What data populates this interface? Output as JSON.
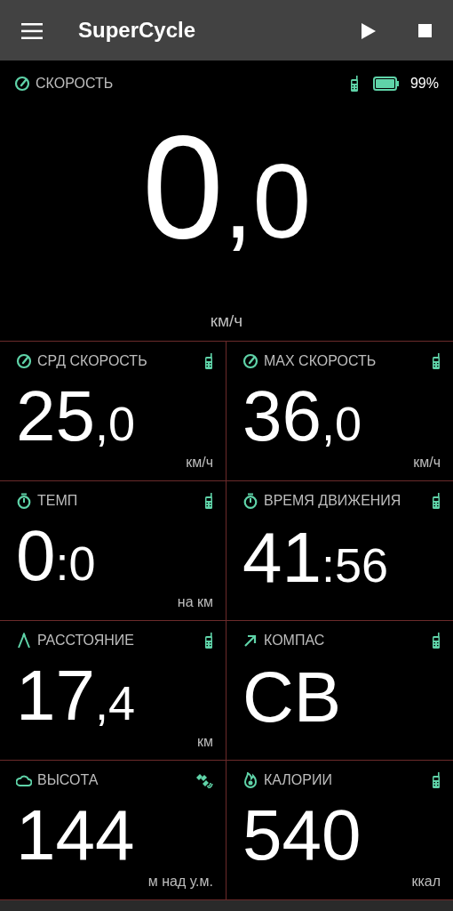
{
  "app_bar": {
    "title": "SuperCycle"
  },
  "speed": {
    "label": "СКОРОСТЬ",
    "kind": "gauge",
    "gps": false,
    "battery": "99%",
    "main": "0",
    "fraction": ",0",
    "unit": "км/ч"
  },
  "tiles": [
    {
      "label": "СРД СКОРОСТЬ",
      "kind": "gauge",
      "gps": false,
      "main": "25",
      "fraction": ",0",
      "unit": "км/ч"
    },
    {
      "label": "MAX СКОРОСТЬ",
      "kind": "gauge",
      "gps": false,
      "main": "36",
      "fraction": ",0",
      "unit": "км/ч"
    },
    {
      "label": "ТЕМП",
      "kind": "timer",
      "gps": false,
      "main": "0",
      "fraction": ":0",
      "unit": "на км"
    },
    {
      "label": "ВРЕМЯ ДВИЖЕНИЯ",
      "kind": "timer",
      "gps": false,
      "main": "41",
      "fraction": ":56"
    },
    {
      "label": "РАССТОЯНИЕ",
      "kind": "distance",
      "gps": false,
      "main": "17",
      "fraction": ",4",
      "unit": "км"
    },
    {
      "label": "КОМПАС",
      "kind": "compass",
      "gps": false,
      "main": "СВ"
    },
    {
      "label": "ВЫСОТА",
      "kind": "altitude",
      "gps": true,
      "main": "144",
      "unit": "м над у.м."
    },
    {
      "label": "КАЛОРИИ",
      "kind": "calories",
      "gps": false,
      "main": "540",
      "unit": "ккал"
    }
  ]
}
